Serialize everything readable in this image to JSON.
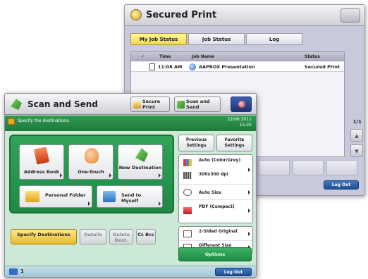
{
  "back_window": {
    "title": "Secured Print",
    "tabs": [
      {
        "label": "My Job Status",
        "active": true
      },
      {
        "label": "Job Status",
        "active": false
      },
      {
        "label": "Log",
        "active": false
      }
    ],
    "table": {
      "columns": [
        "Time",
        "Job Name",
        "Status"
      ],
      "rows": [
        {
          "time": "11:08 AM",
          "job_name": "AAPROX Presentation",
          "status": "Secured Print"
        }
      ]
    },
    "pager": "1/1",
    "logout_label": "Log Out"
  },
  "front_window": {
    "title": "Scan and Send",
    "header_buttons": {
      "secure_print": "Secure Print",
      "scan_and_send": "Scan and Send"
    },
    "status_message": "Specify the destinations.",
    "date": "22/06 2011",
    "time": "15:25",
    "destination_buttons": {
      "address_book": "Address Book",
      "one_touch": "One-Touch",
      "new_destination": "New Destination",
      "personal_folder": "Personal Folder",
      "send_to_myself": "Send to Myself"
    },
    "tabs": {
      "specify_destinations": "Specify Destinations",
      "details": "Details",
      "delete_dest": "Delete Dest.",
      "cc_bcc": "Cc Bcc"
    },
    "settings": {
      "previous_settings": "Previous Settings",
      "favorite_settings": "Favorite Settings",
      "color_mode": "Auto (Color/Grey)",
      "resolution": "300x300 dpi",
      "size": "Auto Size",
      "file_format": "PDF (Compact)",
      "two_sided": "2-Sided Original",
      "different_size": "Different Size Originals",
      "options": "Options"
    },
    "counter": "1",
    "logout_label": "Log Out"
  },
  "colors": {
    "front_accent": "#1f8a45",
    "active_tab": "#f3d84a",
    "logout_button": "#1f4f92"
  }
}
